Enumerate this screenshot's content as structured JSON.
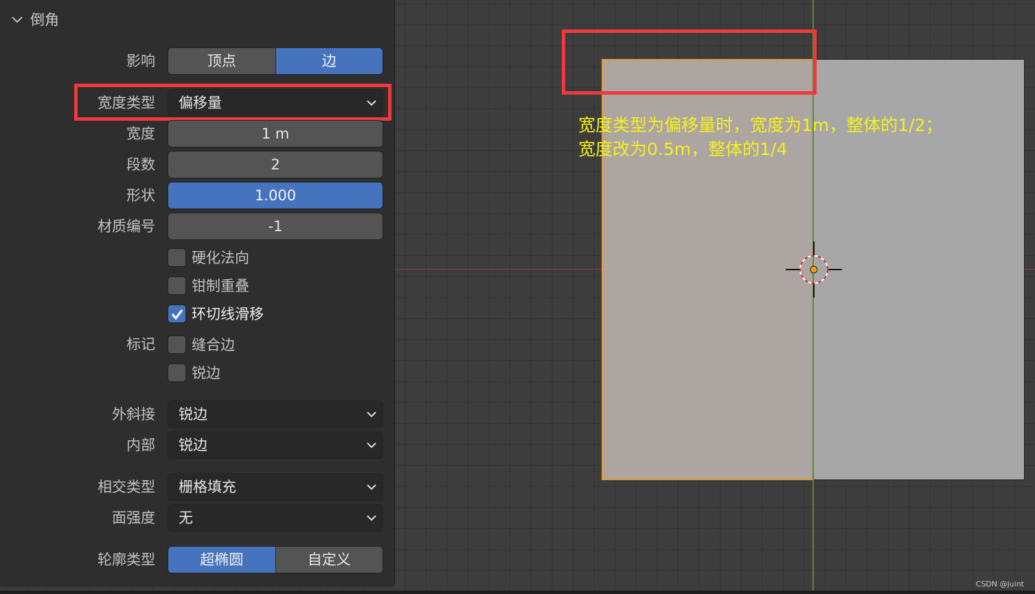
{
  "panel": {
    "title": "倒角",
    "affect": {
      "label": "影响",
      "options": [
        "顶点",
        "边"
      ],
      "selected": "边"
    },
    "width_type": {
      "label": "宽度类型",
      "value": "偏移量"
    },
    "width": {
      "label": "宽度",
      "value": "1 m"
    },
    "segments": {
      "label": "段数",
      "value": "2"
    },
    "shape": {
      "label": "形状",
      "value": "1.000"
    },
    "material_index": {
      "label": "材质编号",
      "value": "-1"
    },
    "harden_normals": {
      "label": "硬化法向",
      "checked": false
    },
    "clamp_overlap": {
      "label": "钳制重叠",
      "checked": false
    },
    "loop_slide": {
      "label": "环切线滑移",
      "checked": true
    },
    "mark": {
      "label": "标记",
      "seam": {
        "label": "缝合边",
        "checked": false
      },
      "sharp": {
        "label": "锐边",
        "checked": false
      }
    },
    "miter_outer": {
      "label": "外斜接",
      "value": "锐边"
    },
    "miter_inner": {
      "label": "内部",
      "value": "锐边"
    },
    "intersection_type": {
      "label": "相交类型",
      "value": "栅格填充"
    },
    "face_strength": {
      "label": "面强度",
      "value": "无"
    },
    "profile_type": {
      "label": "轮廓类型",
      "options": [
        "超椭圆",
        "自定义"
      ],
      "selected": "超椭圆"
    }
  },
  "viewport": {
    "note_line1": "宽度类型为偏移量时，宽度为1m，整体的1/2；",
    "note_line2": "宽度改为0.5m，整体的1/4"
  },
  "watermark": "CSDN @juint",
  "colors": {
    "accent_blue": "#4673bd",
    "highlight_red": "#f0393d",
    "annotation_yellow": "#f4f11c",
    "selection_orange": "#e39c33"
  }
}
